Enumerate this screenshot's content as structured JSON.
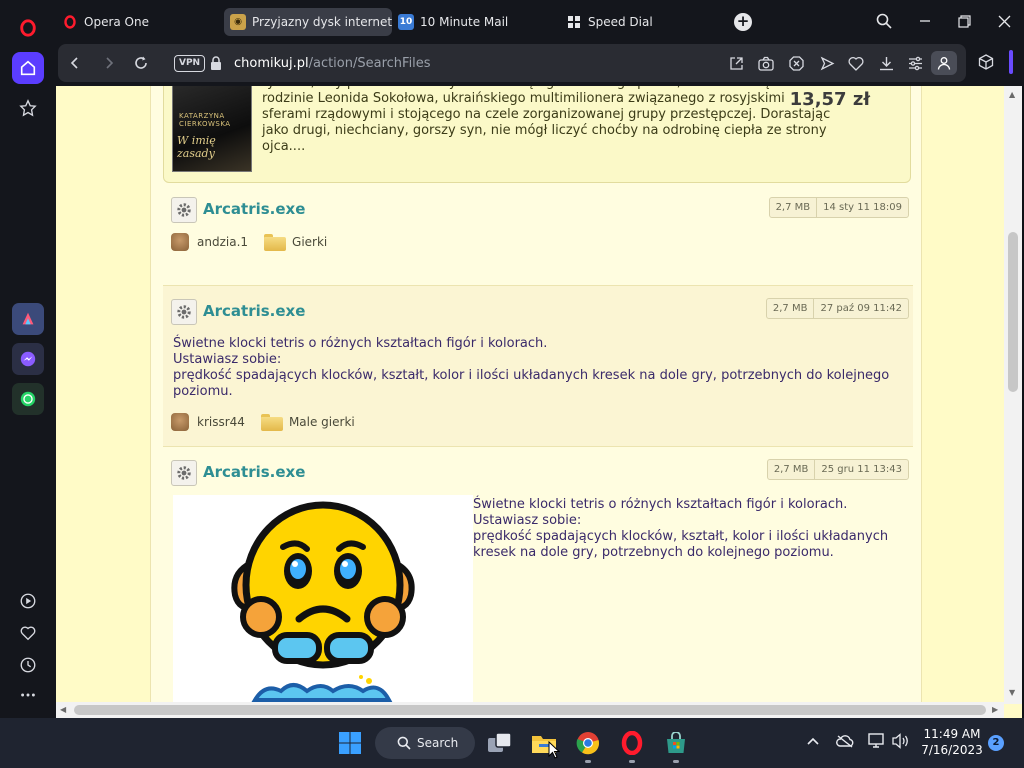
{
  "browser": {
    "tabs": [
      {
        "label": "Opera One",
        "icon": "opera-logo-icon"
      },
      {
        "label": "Przyjazny dysk internetowy",
        "icon": "chomikuj-favicon",
        "active": true
      },
      {
        "label": "10 Minute Mail",
        "icon": "10-minute-mail-favicon"
      },
      {
        "label": "Speed Dial",
        "icon": "speed-dial-grid-icon"
      }
    ],
    "vpn_label": "VPN",
    "url_host": "chomikuj.pl",
    "url_path": "/action/SearchFiles"
  },
  "promo": {
    "book_author": "KATARZYNA CIERKOWSKA",
    "book_title": "W imię zasady",
    "text": "tylko to, aby przetrwać i utrzymać władzę. Igor miał tego pecha, że urodził się w rodzinie Leonida Sokołowa, ukraińskiego multimilionera związanego z rosyjskimi sferami rządowymi i stojącego na czele zorganizowanej grupy przestępczej. Dorastając jako drugi, niechciany, gorszy syn, nie mógł liczyć choćby na odrobinę ciepła ze strony ojca....",
    "price": "13,57 zł"
  },
  "files": [
    {
      "name": "Arcatris.exe",
      "size": "2,7 MB",
      "date": "14 sty 11 18:09",
      "user": "andzia.1",
      "folder": "Gierki"
    },
    {
      "name": "Arcatris.exe",
      "size": "2,7 MB",
      "date": "27 paź 09 11:42",
      "desc_lines": [
        "Świetne klocki tetris o różnych kształtach figór i kolorach.",
        "Ustawiasz sobie:",
        "prędkość spadających klocków, kształt, kolor i ilości układanych kresek na dole gry, potrzebnych do kolejnego",
        "poziomu."
      ],
      "user": "krissr44",
      "folder": "Male gierki"
    },
    {
      "name": "Arcatris.exe",
      "size": "2,7 MB",
      "date": "25 gru 11 13:43",
      "desc_lines": [
        "Świetne klocki tetris o różnych kształtach figór i kolorach.",
        "Ustawiasz sobie:",
        "prędkość spadających klocków, kształt, kolor i ilości układanych",
        "kresek na dole gry, potrzebnych do kolejnego poziomu."
      ]
    }
  ],
  "taskbar": {
    "search_label": "Search",
    "time": "11:49 AM",
    "date": "7/16/2023",
    "notification_count": "2"
  },
  "colors": {
    "page_bg": "#fffbc7",
    "link_teal": "#2e8e93",
    "desc_text": "#3a2a6a",
    "opera_red": "#ff1b2d",
    "sidebar_accent": "#5b3dff"
  }
}
